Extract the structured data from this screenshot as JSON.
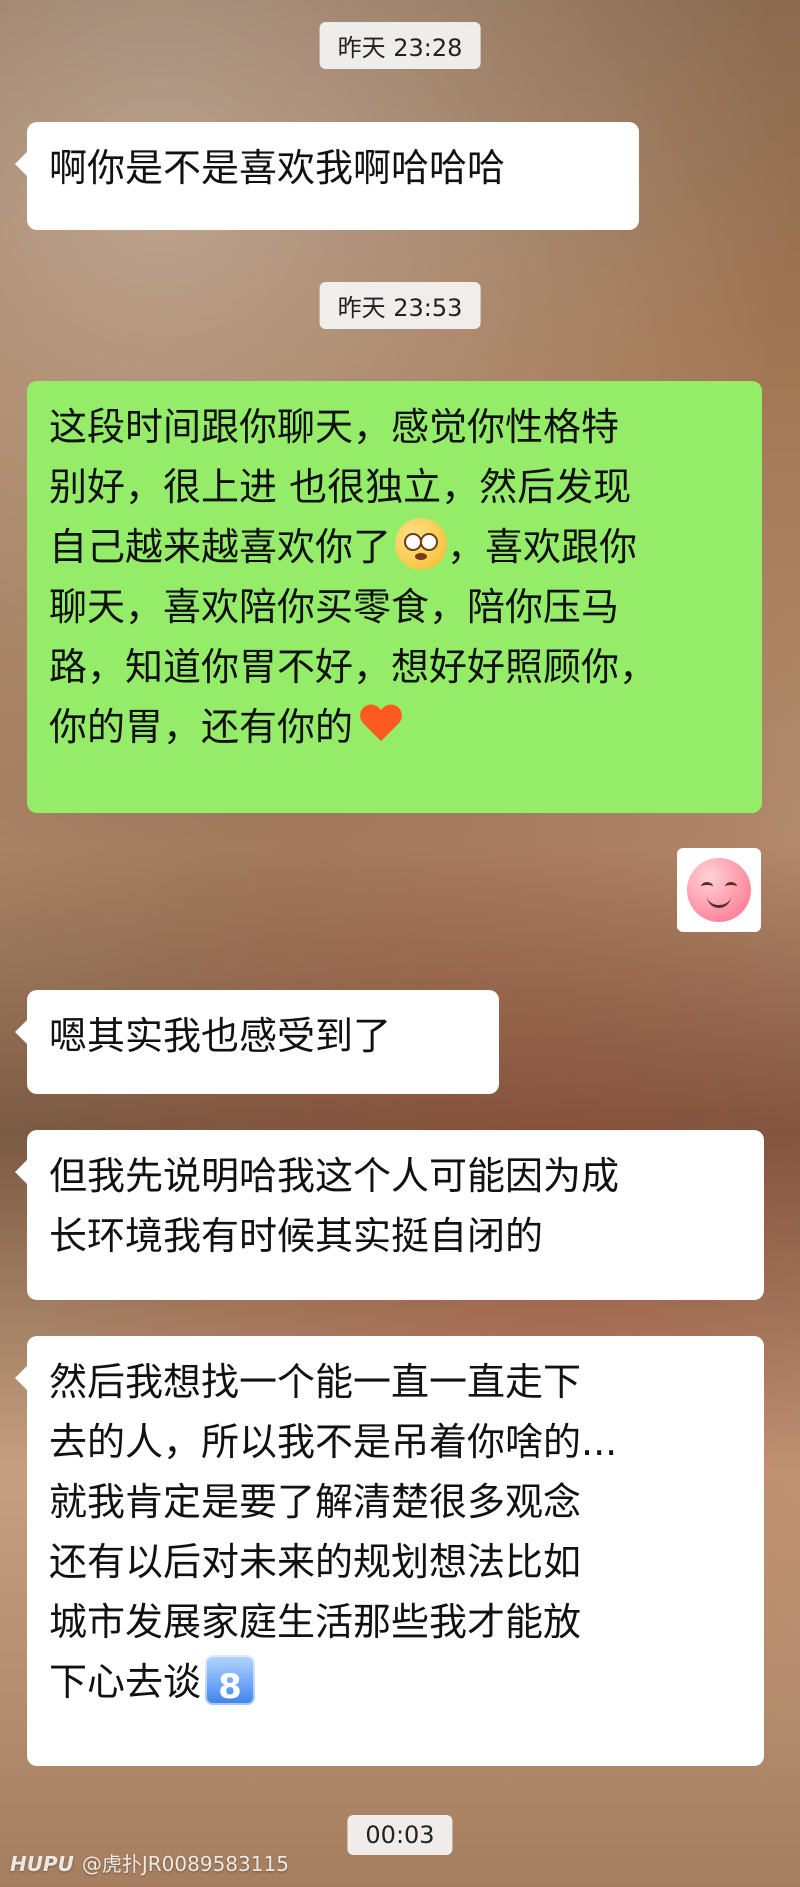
{
  "timestamps": {
    "t1": "昨天 23:28",
    "t2": "昨天 23:53",
    "t3": "00:03"
  },
  "messages": [
    {
      "side": "left",
      "text": "啊你是不是喜欢我啊哈哈哈"
    },
    {
      "side": "right",
      "text_part1": "这段时间跟你聊天，感觉你性格特\n别好，很上进 也很独立，然后发现\n自己越来越喜欢你了",
      "emoji_1": "flushed-face",
      "text_part2": "，喜欢跟你\n聊天，喜欢陪你买零食，陪你压马\n路，知道你胃不好，想好好照顾你，\n你的胃，还有你的",
      "emoji_2": "red-heart"
    },
    {
      "side": "left",
      "text": "嗯其实我也感受到了"
    },
    {
      "side": "left",
      "text": "但我先说明哈我这个人可能因为成\n长环境我有时候其实挺自闭的"
    },
    {
      "side": "left",
      "text_part1": "然后我想找一个能一直一直走下\n去的人，所以我不是吊着你啥的...\n就我肯定是要了解清楚很多观念\n还有以后对未来的规划想法比如\n城市发展家庭生活那些我才能放\n下心去谈",
      "emoji_1": "keycap-8",
      "emoji_1_text": "8"
    }
  ],
  "sticker": {
    "name": "blush-face-sticker"
  },
  "watermark": {
    "brand": "HUPU",
    "text": "@虎扑JR0089583115"
  },
  "colors": {
    "bubble_left": "#ffffff",
    "bubble_right": "#95ec69",
    "timestamp_bg": "#f5f5f5"
  }
}
